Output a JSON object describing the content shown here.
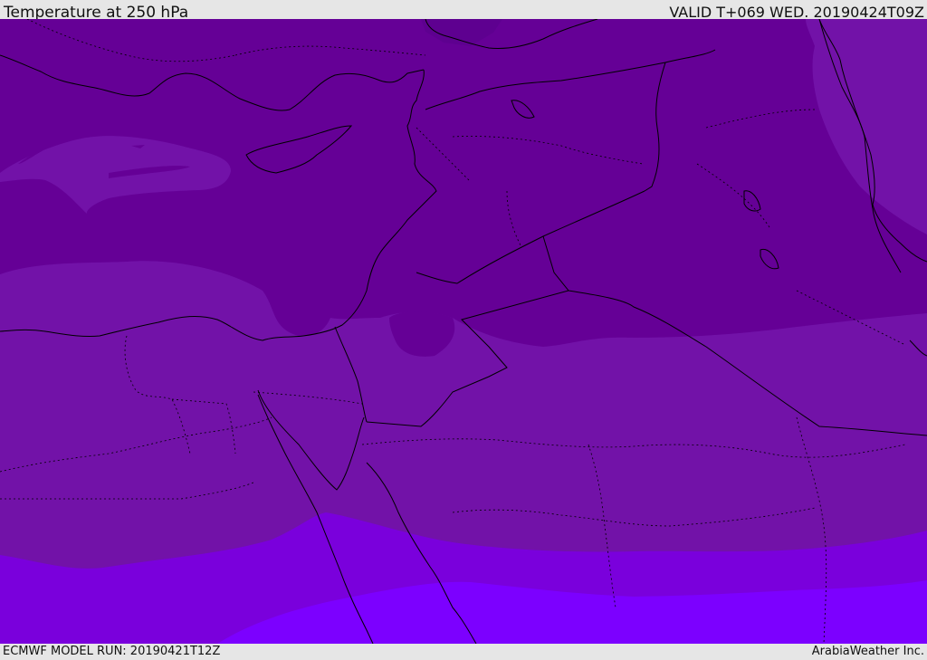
{
  "header": {
    "title": "Temperature at 250 hPa",
    "valid": "VALID T+069 WED. 20190424T09Z"
  },
  "footer": {
    "model_run": "ECMWF MODEL RUN: 20190421T12Z",
    "credit": "ArabiaWeather Inc."
  },
  "map": {
    "field": "Temperature at 250 hPa",
    "colors": {
      "coldest_band": "#5e0090",
      "cold_band": "#650096",
      "mid_band": "#7212a8",
      "warm_band": "#7a00dc",
      "warmest_band": "#7c00ff",
      "coastline": "#000000",
      "border": "#000000"
    }
  }
}
